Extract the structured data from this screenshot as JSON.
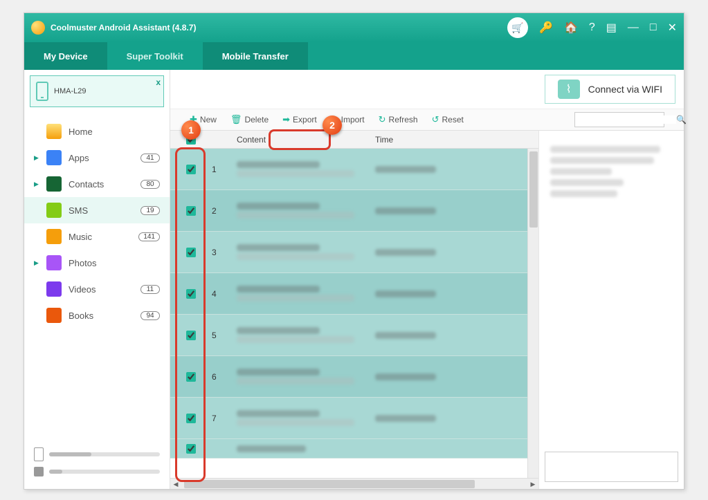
{
  "app": {
    "title": "Coolmuster Android Assistant (4.8.7)"
  },
  "titlebar_icons": [
    "cart",
    "key",
    "home",
    "help",
    "feedback",
    "minimize",
    "maximize",
    "close"
  ],
  "tabs": {
    "my_device": "My Device",
    "super_toolkit": "Super Toolkit",
    "mobile_transfer": "Mobile Transfer"
  },
  "device": {
    "name": "HMA-L29"
  },
  "sidebar": {
    "items": [
      {
        "label": "Home",
        "badge": "",
        "icon": "home",
        "expandable": false
      },
      {
        "label": "Apps",
        "badge": "41",
        "icon": "apps",
        "expandable": true
      },
      {
        "label": "Contacts",
        "badge": "80",
        "icon": "contacts",
        "expandable": true
      },
      {
        "label": "SMS",
        "badge": "19",
        "icon": "sms",
        "expandable": false,
        "active": true
      },
      {
        "label": "Music",
        "badge": "141",
        "icon": "music",
        "expandable": false
      },
      {
        "label": "Photos",
        "badge": "",
        "icon": "photos",
        "expandable": true
      },
      {
        "label": "Videos",
        "badge": "11",
        "icon": "videos",
        "expandable": false
      },
      {
        "label": "Books",
        "badge": "94",
        "icon": "books",
        "expandable": false
      }
    ]
  },
  "storage": {
    "internal_pct": 38,
    "sd_pct": 12
  },
  "connect": {
    "label": "Connect via WIFI"
  },
  "toolbar": {
    "new": "New",
    "delete": "Delete",
    "export": "Export",
    "import": "Import",
    "refresh": "Refresh",
    "reset": "Reset"
  },
  "columns": {
    "content": "Content",
    "time": "Time"
  },
  "rows": [
    1,
    2,
    3,
    4,
    5,
    6,
    7
  ],
  "search": {
    "placeholder": ""
  },
  "annotations": {
    "marker1": "1",
    "marker2": "2"
  }
}
